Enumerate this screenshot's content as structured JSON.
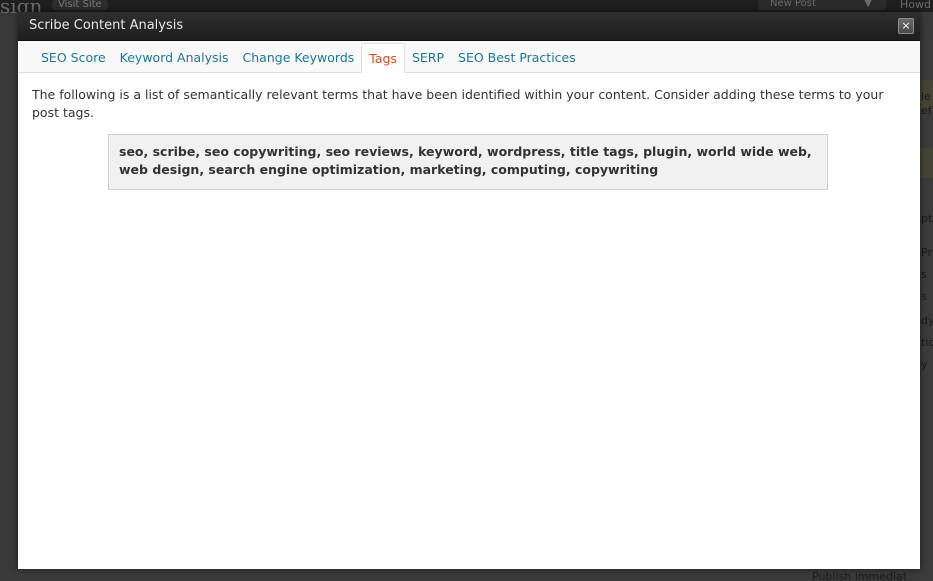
{
  "background": {
    "site_title": "sign",
    "visit_site": "Visit Site",
    "new_post": "New Post",
    "howdy": "Howd",
    "right_fragments": [
      "le",
      "ef",
      "pt",
      "Pr",
      "s",
      "s",
      "dy",
      "tio",
      "y"
    ],
    "bottom_fragment": "Publish immediat"
  },
  "modal": {
    "title": "Scribe Content Analysis",
    "close_glyph": "×",
    "tabs": [
      {
        "label": "SEO Score"
      },
      {
        "label": "Keyword Analysis"
      },
      {
        "label": "Change Keywords"
      },
      {
        "label": "Tags",
        "active": true
      },
      {
        "label": "SERP"
      },
      {
        "label": "SEO Best Practices"
      }
    ],
    "intro": "The following is a list of semantically relevant terms that have been identified within your content. Consider adding these terms to your post tags.",
    "tags_text": "seo, scribe, seo copywriting, seo reviews, keyword, wordpress, title tags, plugin, world wide web, web design, search engine optimization, marketing, computing, copywriting"
  },
  "colors": {
    "link": "#21759b",
    "active_tab": "#d54e21",
    "titlebar": "#2a2a2a"
  }
}
